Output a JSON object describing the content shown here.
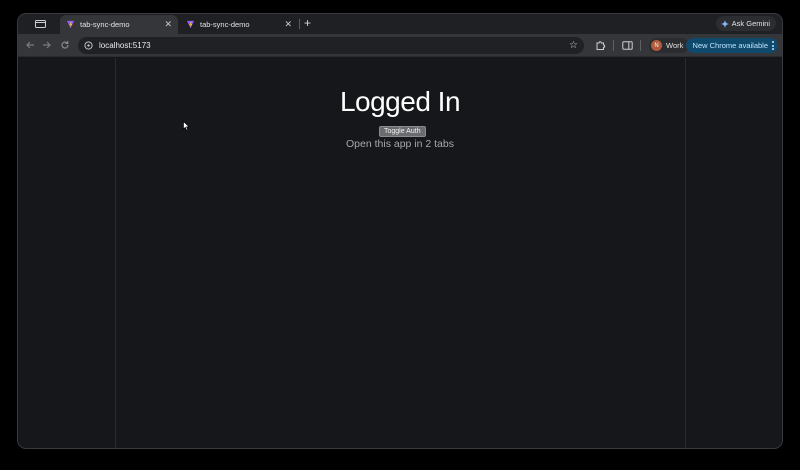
{
  "browser": {
    "tabs": [
      {
        "title": "tab-sync-demo",
        "active": true
      },
      {
        "title": "tab-sync-demo",
        "active": false
      }
    ],
    "new_tab_label": "+",
    "ask_gemini_label": "Ask Gemini",
    "address": "localhost:5173",
    "profile_initial": "N",
    "profile_label": "Work",
    "update_label": "New Chrome available",
    "colors": {
      "favicon": "#8b5cf6",
      "update_bg": "#0f4a6c"
    }
  },
  "page": {
    "heading": "Logged In",
    "toggle_button_label": "Toggle Auth",
    "subtext": "Open this app in 2 tabs"
  }
}
